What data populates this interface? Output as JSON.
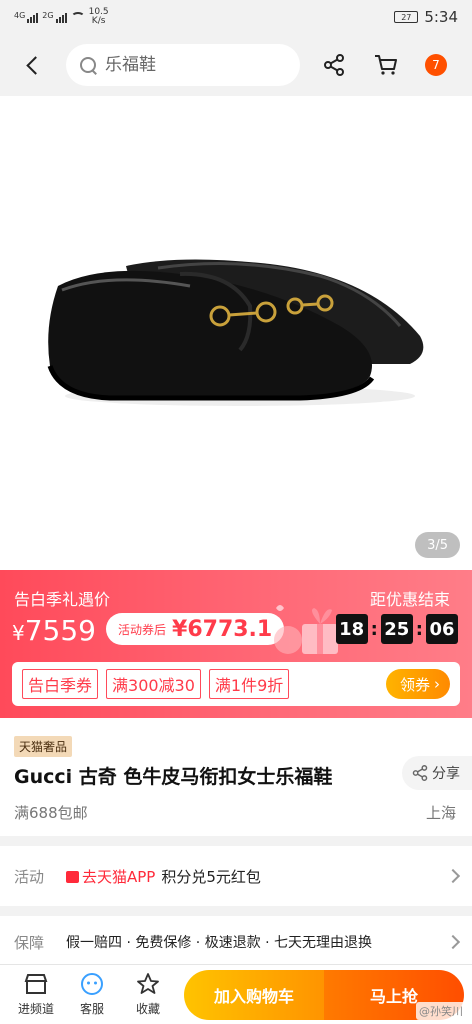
{
  "status_bar": {
    "signal1": "4G",
    "signal2": "2G",
    "speed_value": "10.5",
    "speed_unit": "K/s",
    "battery": "27",
    "time": "5:34"
  },
  "top_nav": {
    "search_placeholder": "乐福鞋",
    "more_badge": "7"
  },
  "gallery": {
    "pager": "3/5"
  },
  "promo": {
    "name": "告白季礼遇价",
    "price_symbol": "¥",
    "price": "7559",
    "coupon_label": "活动券后",
    "coupon_price": "¥6773.1",
    "countdown_label": "距优惠结束",
    "countdown": {
      "hours": "18",
      "minutes": "25",
      "seconds": "06"
    },
    "tags": [
      "告白季券",
      "满300减30",
      "满1件9折"
    ],
    "claim_label": "领券"
  },
  "title_block": {
    "brand_tag": "天猫奢品",
    "title": "Gucci 古奇 色牛皮马衔扣女士乐福鞋",
    "share_label": "分享",
    "shipping": "满688包邮",
    "origin": "上海"
  },
  "activity": {
    "label": "活动",
    "link": "去天猫APP",
    "text": "积分兑5元红包"
  },
  "guarantee": {
    "label": "保障",
    "text": "假一赔四 · 免费保修 · 极速退款 · 七天无理由退换"
  },
  "bottom_bar": {
    "store_label": "进频道",
    "service_label": "客服",
    "fav_label": "收藏",
    "cart_button": "加入购物车",
    "buy_button": "马上抢"
  },
  "watermark": "@孙笑川",
  "colors": {
    "accent": "#ff5000",
    "promo_red": "#ff4a5a",
    "coupon_red": "#ff3b4a",
    "claim_orange": "#ff9400"
  }
}
